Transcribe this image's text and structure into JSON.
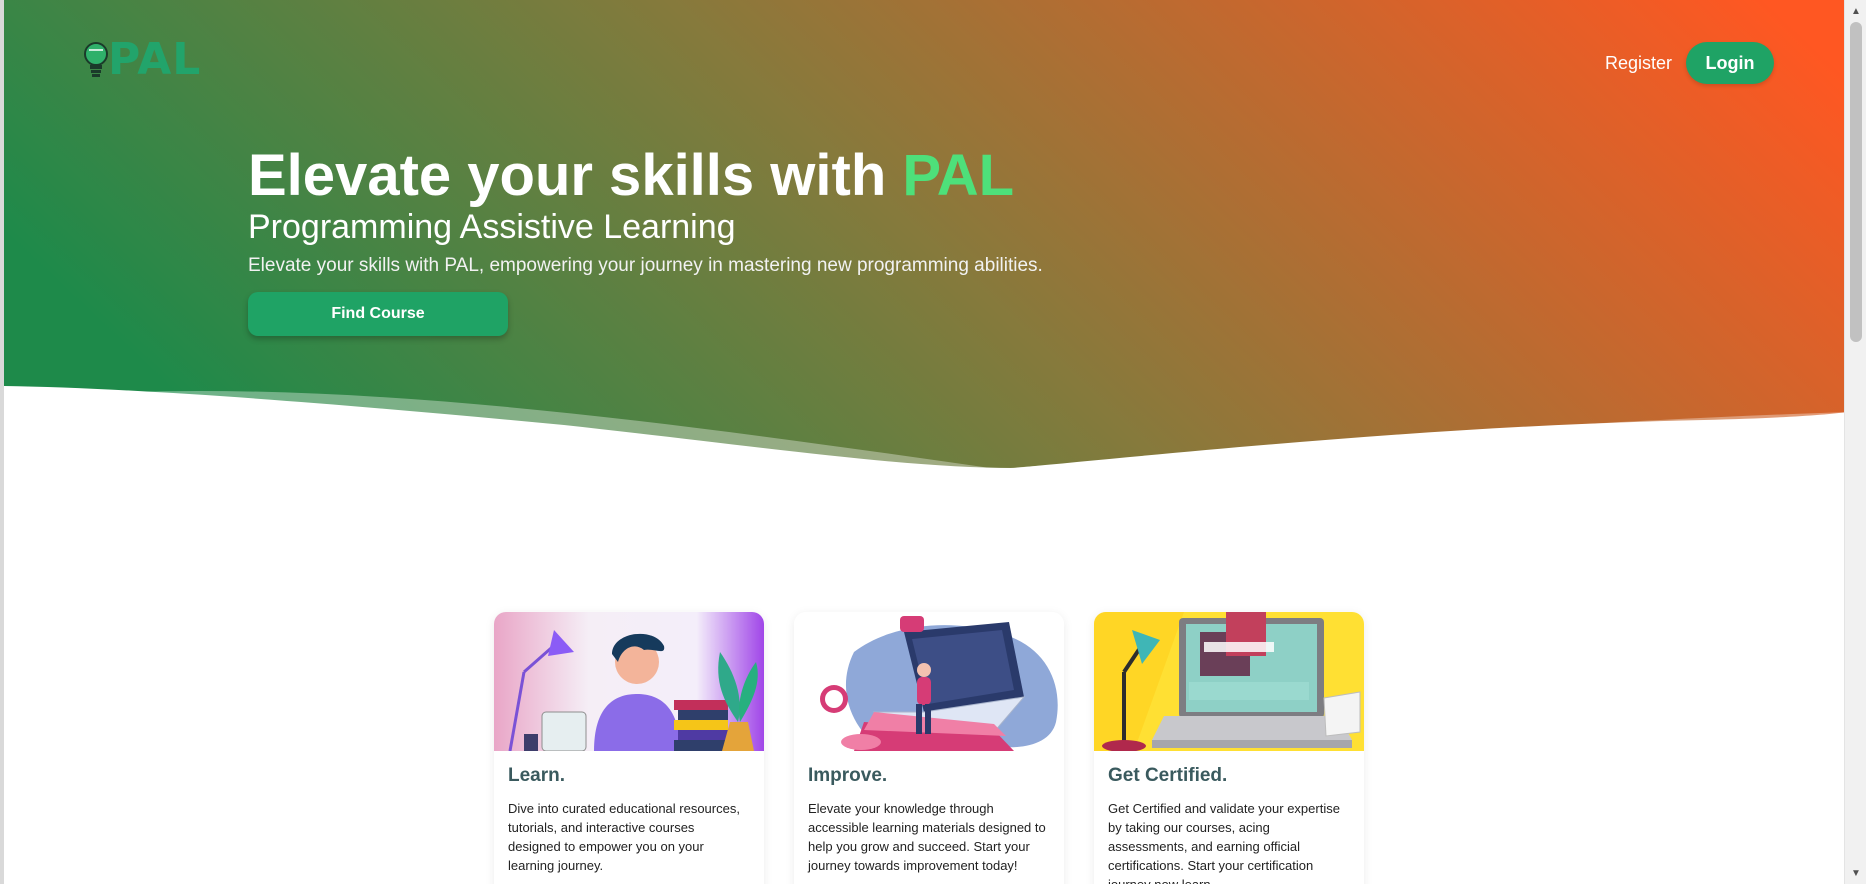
{
  "brand": {
    "logo_text": "PAL",
    "bulb_icon": "lightbulb-icon"
  },
  "nav": {
    "register_label": "Register",
    "login_label": "Login"
  },
  "hero": {
    "title_prefix": "Elevate your skills with ",
    "title_accent": "PAL",
    "subtitle": "Programming Assistive Learning",
    "description": "Elevate your skills with PAL, empowering your journey in mastering new programming abilities.",
    "cta_label": "Find Course"
  },
  "cards": [
    {
      "title": "Learn.",
      "text": "Dive into curated educational resources, tutorials, and interactive courses designed to empower you on your learning journey."
    },
    {
      "title": "Improve.",
      "text": "Elevate your knowledge through accessible learning materials designed to help you grow and succeed. Start your journey towards improvement today!"
    },
    {
      "title": "Get Certified.",
      "text": "Get Certified and validate your expertise by taking our courses, acing assessments, and earning official certifications. Start your certification journey now learn,"
    }
  ],
  "colors": {
    "brand_green": "#1fa365",
    "accent_green": "#4ee07a",
    "gradient_start": "#1e8a4a",
    "gradient_mid": "#857a3c",
    "gradient_end": "#ff5722",
    "card_title": "#3a5a5e"
  }
}
